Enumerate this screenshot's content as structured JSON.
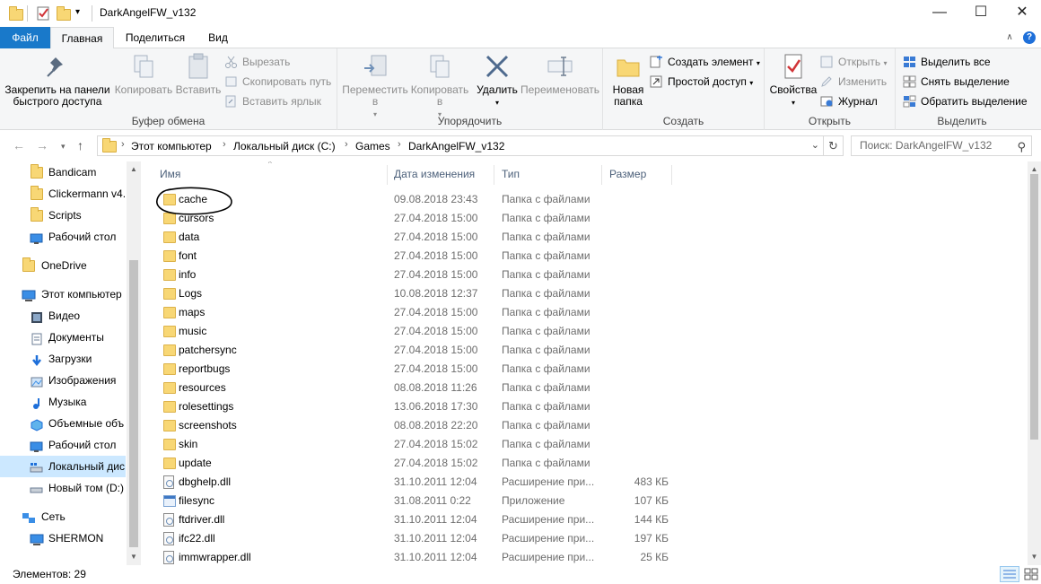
{
  "window": {
    "title": "DarkAngelFW_v132",
    "minimize": "—",
    "maximize": "☐",
    "close": "✕"
  },
  "tabs": {
    "file": "Файл",
    "home": "Главная",
    "share": "Поделиться",
    "view": "Вид"
  },
  "ribbon": {
    "clipboard": {
      "label": "Буфер обмена",
      "pin": "Закрепить на панели быстрого доступа",
      "copy": "Копировать",
      "paste": "Вставить",
      "cut": "Вырезать",
      "copy_path": "Скопировать путь",
      "paste_shortcut": "Вставить ярлык"
    },
    "organize": {
      "label": "Упорядочить",
      "move_to": "Переместить в",
      "copy_to": "Копировать в",
      "delete": "Удалить",
      "rename": "Переименовать"
    },
    "create": {
      "label": "Создать",
      "new_folder": "Новая папка",
      "new_item": "Создать элемент",
      "easy_access": "Простой доступ"
    },
    "open": {
      "label": "Открыть",
      "properties": "Свойства",
      "open": "Открыть",
      "edit": "Изменить",
      "history": "Журнал"
    },
    "select": {
      "label": "Выделить",
      "select_all": "Выделить все",
      "select_none": "Снять выделение",
      "invert": "Обратить выделение"
    }
  },
  "address": {
    "crumbs": [
      "Этот компьютер",
      "Локальный диск (C:)",
      "Games",
      "DarkAngelFW_v132"
    ],
    "search_placeholder": "Поиск: DarkAngelFW_v132"
  },
  "nav": {
    "items": [
      "Bandicam",
      "Clickermann v4.",
      "Scripts",
      "Рабочий стол",
      "OneDrive",
      "Этот компьютер",
      "Видео",
      "Документы",
      "Загрузки",
      "Изображения",
      "Музыка",
      "Объемные объ",
      "Рабочий стол",
      "Локальный дис",
      "Новый том (D:)",
      "Сеть",
      "SHERMON"
    ]
  },
  "columns": {
    "name": "Имя",
    "date": "Дата изменения",
    "type": "Тип",
    "size": "Размер"
  },
  "files": [
    {
      "name": "cache",
      "date": "09.08.2018 23:43",
      "type": "Папка с файлами",
      "size": "",
      "kind": "folder"
    },
    {
      "name": "cursors",
      "date": "27.04.2018 15:00",
      "type": "Папка с файлами",
      "size": "",
      "kind": "folder"
    },
    {
      "name": "data",
      "date": "27.04.2018 15:00",
      "type": "Папка с файлами",
      "size": "",
      "kind": "folder"
    },
    {
      "name": "font",
      "date": "27.04.2018 15:00",
      "type": "Папка с файлами",
      "size": "",
      "kind": "folder"
    },
    {
      "name": "info",
      "date": "27.04.2018 15:00",
      "type": "Папка с файлами",
      "size": "",
      "kind": "folder"
    },
    {
      "name": "Logs",
      "date": "10.08.2018 12:37",
      "type": "Папка с файлами",
      "size": "",
      "kind": "folder"
    },
    {
      "name": "maps",
      "date": "27.04.2018 15:00",
      "type": "Папка с файлами",
      "size": "",
      "kind": "folder"
    },
    {
      "name": "music",
      "date": "27.04.2018 15:00",
      "type": "Папка с файлами",
      "size": "",
      "kind": "folder"
    },
    {
      "name": "patchersync",
      "date": "27.04.2018 15:00",
      "type": "Папка с файлами",
      "size": "",
      "kind": "folder"
    },
    {
      "name": "reportbugs",
      "date": "27.04.2018 15:00",
      "type": "Папка с файлами",
      "size": "",
      "kind": "folder"
    },
    {
      "name": "resources",
      "date": "08.08.2018 11:26",
      "type": "Папка с файлами",
      "size": "",
      "kind": "folder"
    },
    {
      "name": "rolesettings",
      "date": "13.06.2018 17:30",
      "type": "Папка с файлами",
      "size": "",
      "kind": "folder"
    },
    {
      "name": "screenshots",
      "date": "08.08.2018 22:20",
      "type": "Папка с файлами",
      "size": "",
      "kind": "folder"
    },
    {
      "name": "skin",
      "date": "27.04.2018 15:02",
      "type": "Папка с файлами",
      "size": "",
      "kind": "folder"
    },
    {
      "name": "update",
      "date": "27.04.2018 15:02",
      "type": "Папка с файлами",
      "size": "",
      "kind": "folder"
    },
    {
      "name": "dbghelp.dll",
      "date": "31.10.2011 12:04",
      "type": "Расширение при...",
      "size": "483 КБ",
      "kind": "dll"
    },
    {
      "name": "filesync",
      "date": "31.08.2011 0:22",
      "type": "Приложение",
      "size": "107 КБ",
      "kind": "exe"
    },
    {
      "name": "ftdriver.dll",
      "date": "31.10.2011 12:04",
      "type": "Расширение при...",
      "size": "144 КБ",
      "kind": "dll"
    },
    {
      "name": "ifc22.dll",
      "date": "31.10.2011 12:04",
      "type": "Расширение при...",
      "size": "197 КБ",
      "kind": "dll"
    },
    {
      "name": "immwrapper.dll",
      "date": "31.10.2011 12:04",
      "type": "Расширение при...",
      "size": "25 КБ",
      "kind": "dll"
    }
  ],
  "status": {
    "items_count": "Элементов: 29"
  },
  "colors": {
    "file_tab": "#1979ca",
    "folder": "#f8d775",
    "selection": "#cce8ff",
    "column_header": "#4c607a",
    "annotation": "#000000"
  }
}
